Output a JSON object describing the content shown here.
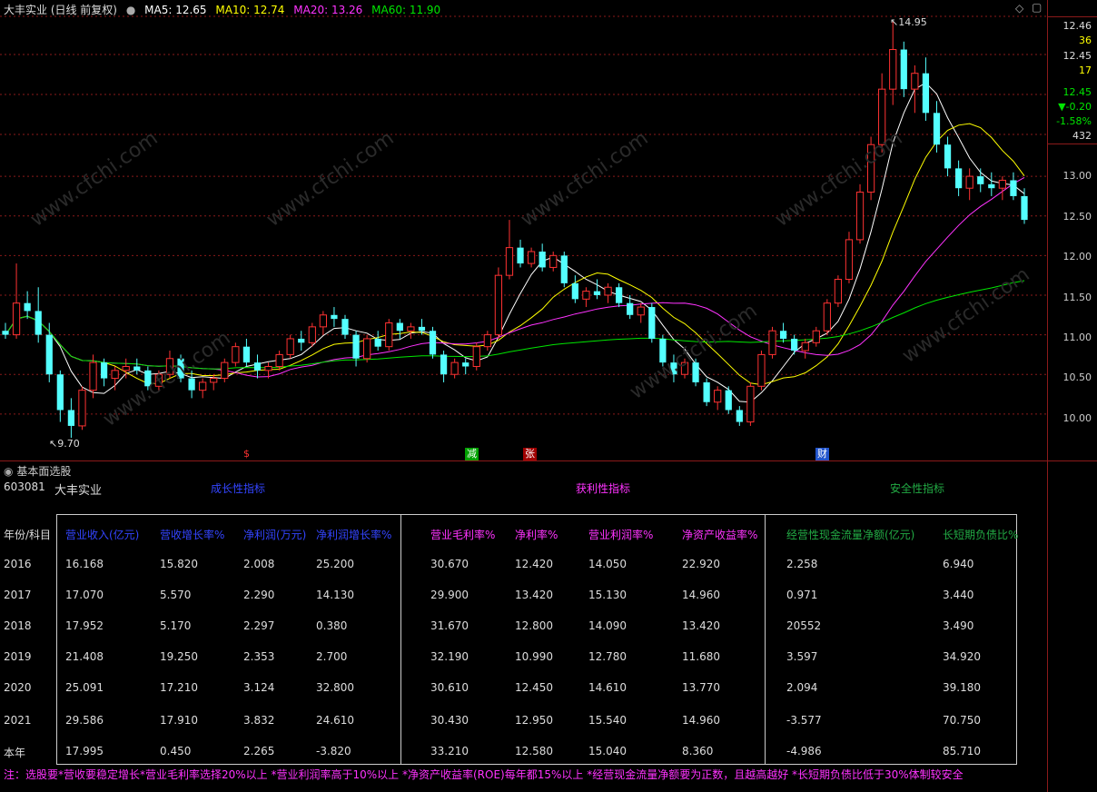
{
  "header": {
    "stock_title": "大丰实业 (日线 前复权)",
    "ma5": "MA5: 12.65",
    "ma10": "MA10: 12.74",
    "ma20": "MA20: 13.26",
    "ma60": "MA60: 11.90"
  },
  "colors": {
    "up": "#ff3232",
    "down": "#54ffff",
    "ma5": "#ffffff",
    "ma10": "#ffff00",
    "ma20": "#ff33ff",
    "ma60": "#00e600",
    "grid": "#8b1a1a"
  },
  "price_axis": {
    "ticks": [
      "13.00",
      "12.50",
      "12.00",
      "11.50",
      "11.00",
      "10.50",
      "10.00"
    ],
    "quote": {
      "price1": "12.46",
      "vol1": "36",
      "price2": "12.45",
      "vol2": "17",
      "last": "12.45",
      "change": "▼-0.20",
      "change_pct": "-1.58%",
      "volume": "432"
    }
  },
  "annotations": {
    "high": "14.95",
    "low": "9.70"
  },
  "markers": [
    {
      "label": "$",
      "color": "#ff3232"
    },
    {
      "label": "减",
      "color": "#00c000"
    },
    {
      "label": "张",
      "color": "#ff3232"
    },
    {
      "label": "财",
      "color": "#4488ff"
    }
  ],
  "chart_data": {
    "type": "candlestick",
    "ylim": [
      9.7,
      14.95
    ],
    "grid": true,
    "high_label": 14.95,
    "low_label": 9.7,
    "ma_current": {
      "MA5": 12.65,
      "MA10": 12.74,
      "MA20": 13.26,
      "MA60": 11.9
    },
    "ohlc": [
      [
        11.05,
        11.15,
        10.95,
        11.0
      ],
      [
        11.0,
        11.9,
        10.95,
        11.4
      ],
      [
        11.4,
        11.55,
        11.2,
        11.3
      ],
      [
        11.3,
        11.6,
        10.9,
        11.0
      ],
      [
        11.0,
        11.15,
        10.4,
        10.5
      ],
      [
        10.5,
        10.55,
        9.9,
        10.05
      ],
      [
        10.05,
        10.2,
        9.7,
        9.85
      ],
      [
        9.85,
        10.35,
        9.8,
        10.3
      ],
      [
        10.3,
        10.75,
        10.2,
        10.65
      ],
      [
        10.65,
        10.7,
        10.35,
        10.45
      ],
      [
        10.45,
        10.6,
        10.3,
        10.55
      ],
      [
        10.55,
        10.7,
        10.45,
        10.6
      ],
      [
        10.6,
        10.7,
        10.5,
        10.55
      ],
      [
        10.55,
        10.6,
        10.3,
        10.35
      ],
      [
        10.35,
        10.55,
        10.3,
        10.5
      ],
      [
        10.5,
        10.8,
        10.45,
        10.7
      ],
      [
        10.7,
        10.75,
        10.4,
        10.45
      ],
      [
        10.45,
        10.55,
        10.2,
        10.3
      ],
      [
        10.3,
        10.45,
        10.2,
        10.4
      ],
      [
        10.4,
        10.5,
        10.3,
        10.45
      ],
      [
        10.45,
        10.7,
        10.4,
        10.65
      ],
      [
        10.65,
        10.9,
        10.6,
        10.85
      ],
      [
        10.85,
        10.95,
        10.6,
        10.65
      ],
      [
        10.65,
        10.75,
        10.45,
        10.55
      ],
      [
        10.55,
        10.65,
        10.45,
        10.6
      ],
      [
        10.6,
        10.8,
        10.55,
        10.75
      ],
      [
        10.75,
        11.0,
        10.7,
        10.95
      ],
      [
        10.95,
        11.05,
        10.8,
        10.9
      ],
      [
        10.9,
        11.15,
        10.85,
        11.1
      ],
      [
        11.1,
        11.3,
        11.0,
        11.25
      ],
      [
        11.25,
        11.35,
        11.1,
        11.2
      ],
      [
        11.2,
        11.25,
        10.95,
        11.0
      ],
      [
        11.0,
        11.05,
        10.6,
        10.7
      ],
      [
        10.7,
        11.0,
        10.65,
        10.95
      ],
      [
        10.95,
        11.05,
        10.8,
        10.85
      ],
      [
        10.85,
        11.2,
        10.8,
        11.15
      ],
      [
        11.15,
        11.2,
        10.95,
        11.05
      ],
      [
        11.05,
        11.15,
        10.95,
        11.1
      ],
      [
        11.1,
        11.2,
        11.0,
        11.05
      ],
      [
        11.05,
        11.1,
        10.7,
        10.75
      ],
      [
        10.75,
        10.8,
        10.4,
        10.5
      ],
      [
        10.5,
        10.7,
        10.45,
        10.65
      ],
      [
        10.65,
        10.7,
        10.5,
        10.6
      ],
      [
        10.6,
        10.9,
        10.55,
        10.85
      ],
      [
        10.85,
        11.05,
        10.8,
        11.0
      ],
      [
        11.0,
        11.85,
        10.95,
        11.75
      ],
      [
        11.75,
        12.45,
        11.7,
        12.1
      ],
      [
        12.1,
        12.2,
        11.85,
        11.9
      ],
      [
        11.9,
        12.1,
        11.85,
        12.05
      ],
      [
        12.05,
        12.15,
        11.8,
        11.85
      ],
      [
        11.85,
        12.05,
        11.8,
        12.0
      ],
      [
        12.0,
        12.05,
        11.6,
        11.65
      ],
      [
        11.65,
        11.75,
        11.4,
        11.45
      ],
      [
        11.45,
        11.6,
        11.35,
        11.55
      ],
      [
        11.55,
        11.7,
        11.45,
        11.5
      ],
      [
        11.5,
        11.65,
        11.4,
        11.6
      ],
      [
        11.6,
        11.65,
        11.35,
        11.4
      ],
      [
        11.4,
        11.5,
        11.2,
        11.25
      ],
      [
        11.25,
        11.4,
        11.15,
        11.35
      ],
      [
        11.35,
        11.4,
        10.9,
        10.95
      ],
      [
        10.95,
        11.0,
        10.6,
        10.65
      ],
      [
        10.65,
        10.75,
        10.4,
        10.5
      ],
      [
        10.5,
        10.7,
        10.45,
        10.65
      ],
      [
        10.65,
        10.7,
        10.35,
        10.4
      ],
      [
        10.4,
        10.45,
        10.1,
        10.15
      ],
      [
        10.15,
        10.35,
        10.05,
        10.3
      ],
      [
        10.3,
        10.35,
        10.0,
        10.05
      ],
      [
        10.05,
        10.1,
        9.85,
        9.9
      ],
      [
        9.9,
        10.4,
        9.85,
        10.35
      ],
      [
        10.35,
        10.8,
        10.3,
        10.75
      ],
      [
        10.75,
        11.1,
        10.7,
        11.05
      ],
      [
        11.05,
        11.15,
        10.9,
        10.95
      ],
      [
        10.95,
        11.0,
        10.75,
        10.8
      ],
      [
        10.8,
        10.95,
        10.7,
        10.9
      ],
      [
        10.9,
        11.1,
        10.85,
        11.05
      ],
      [
        11.05,
        11.45,
        11.0,
        11.4
      ],
      [
        11.4,
        11.75,
        11.35,
        11.7
      ],
      [
        11.7,
        12.3,
        11.65,
        12.2
      ],
      [
        12.2,
        12.9,
        12.15,
        12.8
      ],
      [
        12.8,
        13.5,
        12.7,
        13.4
      ],
      [
        13.4,
        14.3,
        13.3,
        14.1
      ],
      [
        14.1,
        14.95,
        13.9,
        14.6
      ],
      [
        14.6,
        14.7,
        14.0,
        14.1
      ],
      [
        14.1,
        14.4,
        13.8,
        14.3
      ],
      [
        14.3,
        14.5,
        13.7,
        13.8
      ],
      [
        13.8,
        13.95,
        13.3,
        13.4
      ],
      [
        13.4,
        13.5,
        13.0,
        13.1
      ],
      [
        13.1,
        13.2,
        12.75,
        12.85
      ],
      [
        12.85,
        13.1,
        12.7,
        13.0
      ],
      [
        13.0,
        13.1,
        12.8,
        12.9
      ],
      [
        12.9,
        13.05,
        12.75,
        12.85
      ],
      [
        12.85,
        13.0,
        12.7,
        12.95
      ],
      [
        12.95,
        13.05,
        12.7,
        12.75
      ],
      [
        12.75,
        12.85,
        12.4,
        12.45
      ]
    ]
  },
  "fundamentals": {
    "panel_title": "基本面选股",
    "code": "603081",
    "name": "大丰实业",
    "groups": [
      {
        "title": "成长性指标",
        "color": "#3344ff"
      },
      {
        "title": "获利性指标",
        "color": "#ff33ff"
      },
      {
        "title": "安全性指标",
        "color": "#22aa44"
      }
    ],
    "row_header": "年份/科目",
    "columns": [
      {
        "label": "营业收入(亿元)",
        "color": "#3344ff"
      },
      {
        "label": "营收增长率%",
        "color": "#3344ff"
      },
      {
        "label": "净利润(万元)",
        "color": "#3344ff"
      },
      {
        "label": "净利润增长率%",
        "color": "#3344ff"
      },
      {
        "label": "营业毛利率%",
        "color": "#ff33ff"
      },
      {
        "label": "净利率%",
        "color": "#ff33ff"
      },
      {
        "label": "营业利润率%",
        "color": "#ff33ff"
      },
      {
        "label": "净资产收益率%",
        "color": "#ff33ff"
      },
      {
        "label": "经营性现金流量净额(亿元)",
        "color": "#22aa44"
      },
      {
        "label": "长短期负债比%",
        "color": "#22aa44"
      }
    ],
    "rows": [
      {
        "year": "2016",
        "values": [
          "16.168",
          "15.820",
          "2.008",
          "25.200",
          "30.670",
          "12.420",
          "14.050",
          "22.920",
          "2.258",
          "6.940"
        ]
      },
      {
        "year": "2017",
        "values": [
          "17.070",
          "5.570",
          "2.290",
          "14.130",
          "29.900",
          "13.420",
          "15.130",
          "14.960",
          "0.971",
          "3.440"
        ]
      },
      {
        "year": "2018",
        "values": [
          "17.952",
          "5.170",
          "2.297",
          "0.380",
          "31.670",
          "12.800",
          "14.090",
          "13.420",
          "20552",
          "3.490"
        ]
      },
      {
        "year": "2019",
        "values": [
          "21.408",
          "19.250",
          "2.353",
          "2.700",
          "32.190",
          "10.990",
          "12.780",
          "11.680",
          "3.597",
          "34.920"
        ]
      },
      {
        "year": "2020",
        "values": [
          "25.091",
          "17.210",
          "3.124",
          "32.800",
          "30.610",
          "12.450",
          "14.610",
          "13.770",
          "2.094",
          "39.180"
        ]
      },
      {
        "year": "2021",
        "values": [
          "29.586",
          "17.910",
          "3.832",
          "24.610",
          "30.430",
          "12.950",
          "15.540",
          "14.960",
          "-3.577",
          "70.750"
        ]
      },
      {
        "year": "本年",
        "values": [
          "17.995",
          "0.450",
          "2.265",
          "-3.820",
          "33.210",
          "12.580",
          "15.040",
          "8.360",
          "-4.986",
          "85.710"
        ]
      }
    ],
    "note": "注：选股要*营收要稳定增长*营业毛利率选择20%以上 *营业利润率高于10%以上 *净资产收益率(ROE)每年都15%以上 *经营现金流量净额要为正数，且越高越好 *长短期负债比低于30%体制较安全"
  },
  "watermark": "www.cfchi.com"
}
